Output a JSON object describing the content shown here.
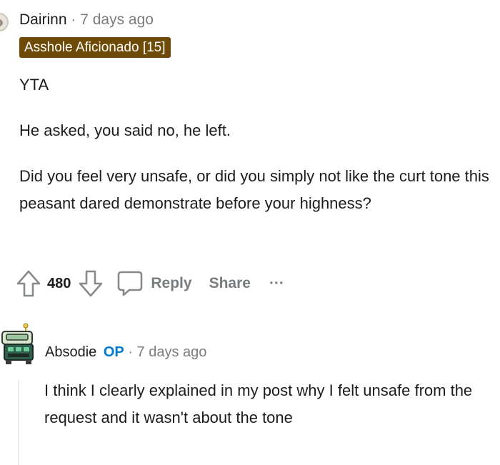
{
  "comments": [
    {
      "username": "Dairinn",
      "separator": "·",
      "timestamp": "7 days ago",
      "flair": "Asshole Aficionado [15]",
      "paragraphs": [
        "YTA",
        "He asked, you said no, he left.",
        "Did you feel very unsafe, or did you simply not like the curt tone this peasant dared demonstrate before your highness?"
      ],
      "actions": {
        "upvote_icon": "upvote-arrow-icon",
        "score": "480",
        "downvote_icon": "downvote-arrow-icon",
        "reply_icon": "speech-bubble-icon",
        "reply_label": "Reply",
        "share_label": "Share",
        "more_label": "···"
      }
    },
    {
      "username": "Absodie",
      "op_badge": "OP",
      "separator": "·",
      "timestamp": "7 days ago",
      "avatar_icon": "robot-avatar-icon",
      "paragraphs": [
        "I think I clearly explained in my post why I felt unsafe from the request and it wasn't about the tone"
      ]
    }
  ],
  "colors": {
    "flair_bg": "#6e4a07",
    "op_badge": "#0079d3",
    "muted_text": "#7c7c7c",
    "action_text": "#787c7e"
  }
}
